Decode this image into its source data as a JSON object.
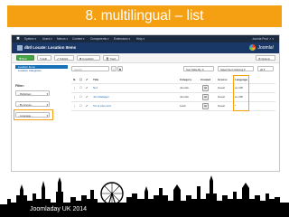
{
  "slide": {
    "title": "8. multilingual – list",
    "footer": "Joomladay UK 2014",
    "accent_color": "#f5a012"
  },
  "topbar": {
    "icon": "joomla-icon",
    "menu": [
      "System ▾",
      "Users ▾",
      "Menus ▾",
      "Content ▾",
      "Components ▾",
      "Extensions ▾",
      "Help ▾"
    ],
    "right": "Joomla Prod ↗  ▾"
  },
  "header": {
    "title": "dbtl Locate: Location Items",
    "logo": "Joomla!"
  },
  "toolbar": {
    "new": "New",
    "edit": "Edit",
    "publish": "Publish",
    "unpublish": "Unpublish",
    "trash": "Trash",
    "options": "Options"
  },
  "sidebar": {
    "items": [
      {
        "label": "Location Items",
        "active": true
      },
      {
        "label": "Location Categories",
        "active": false
      }
    ]
  },
  "filters": {
    "heading": "Filter:",
    "status": "- Published -",
    "access": "- By Access -",
    "language": "- Language -"
  },
  "search": {
    "placeholder": "Search"
  },
  "sort": {
    "ordering": "Sort Table By:",
    "direction": "Select Sort Ordering",
    "limit": "20"
  },
  "table": {
    "columns": {
      "title": "Title",
      "category": "Category",
      "created": "Created",
      "access": "Access",
      "language": "Language"
    },
    "rows": [
      {
        "title": "Nef",
        "category": "Joomla",
        "created": "▤",
        "access": "Guest",
        "language": "en-GB"
      },
      {
        "title": "Joomladagen",
        "category": "Joomla",
        "created": "▤",
        "access": "Guest",
        "language": "en-GB"
      },
      {
        "title": "Tot te plus tard",
        "category": "Letar",
        "created": "▤",
        "access": "Guest",
        "language": "*"
      }
    ]
  }
}
